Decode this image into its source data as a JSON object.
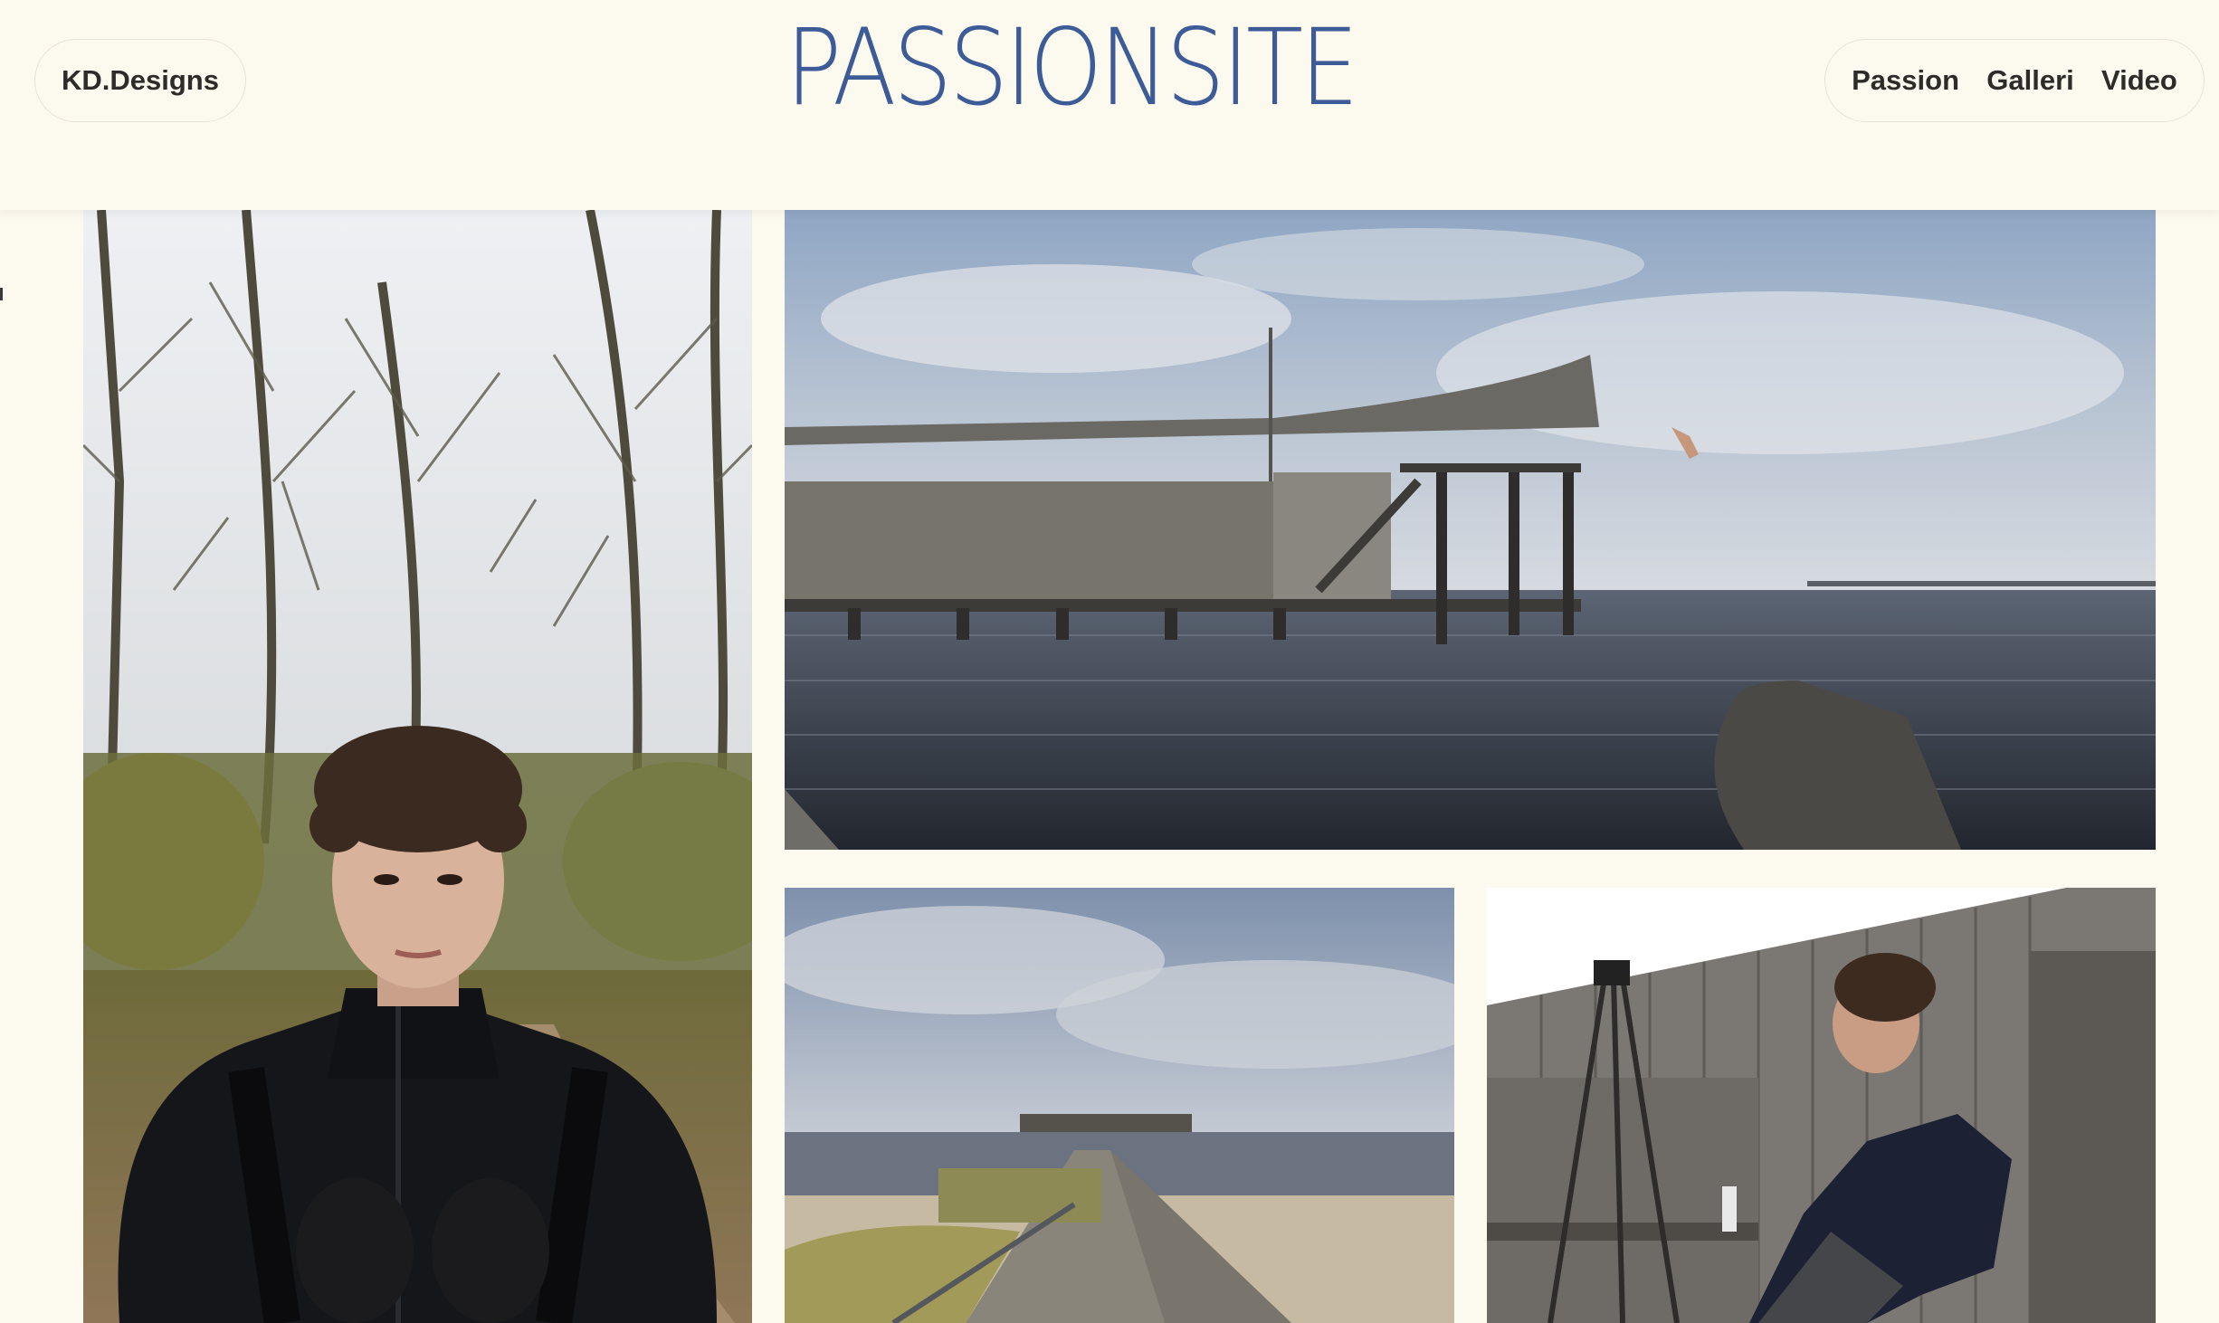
{
  "header": {
    "logo_text": "KD.Designs",
    "site_title": "PASSIONSITE",
    "nav": [
      {
        "label": "Passion"
      },
      {
        "label": "Galleri"
      },
      {
        "label": "Video"
      }
    ]
  },
  "colors": {
    "background": "#fcf9ef",
    "title_blue": "#3c5b97",
    "nav_text": "#2e2c29"
  },
  "gallery": {
    "photos": [
      {
        "subject": "portrait"
      },
      {
        "subject": "pier"
      },
      {
        "subject": "boardwalk"
      },
      {
        "subject": "tripod"
      }
    ]
  }
}
